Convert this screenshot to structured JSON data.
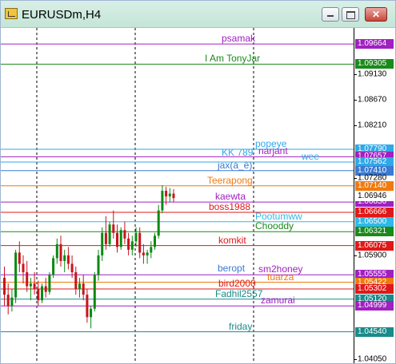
{
  "window": {
    "title": "EURUSDm,H4",
    "buttons": {
      "minimize": "–",
      "maximize": "□",
      "close": "✕"
    }
  },
  "colors": {
    "background": "#ffffff",
    "bull_candle": "#0a8a12",
    "bear_candle": "#c8141e",
    "grid": "#000000"
  },
  "price_axis": {
    "ticks": [
      "1.09130",
      "1.08670",
      "1.08210",
      "1.07280",
      "1.05900",
      "1.04050"
    ]
  },
  "levels": [
    {
      "name": "psamak",
      "price": "1.09664",
      "color": "#a020c0",
      "tag_color": "#a020c0"
    },
    {
      "name": "I Am TonyJar",
      "price": "1.09305",
      "color": "#1a8a1a",
      "tag_color": "#1a8a1a"
    },
    {
      "name": "popeye",
      "price": "1.07790",
      "color": "#30a8e8",
      "tag_color": "#30a8e8"
    },
    {
      "name": "narjant",
      "price": "1.07657",
      "color": "#a020c0",
      "tag_color": "#a020c0"
    },
    {
      "name": "KK 789",
      "price": "",
      "color": "#30a8e8",
      "tag_color": "#30a8e8"
    },
    {
      "name": "wee",
      "price": "1.07562",
      "color": "#30a8e8",
      "tag_color": "#30a8e8"
    },
    {
      "name": "jax(à_ê)",
      "price": "1.07410",
      "color": "#3a7ad0",
      "tag_color": "#3a7ad0"
    },
    {
      "name": "Teerapong",
      "price": "1.07140",
      "color": "#f07a10",
      "tag_color": "#f07a10"
    },
    {
      "name": "kaewta",
      "price": "1.06850",
      "color": "#a020c0",
      "tag_color": "#a020c0"
    },
    {
      "name": "boss1988",
      "price": "1.06666",
      "color": "#e01818",
      "tag_color": "#e01818"
    },
    {
      "name": "Pootumww",
      "price": "1.06500",
      "color": "#30b8e8",
      "tag_color": "#30b8e8"
    },
    {
      "name": "Chooddy",
      "price": "1.06321",
      "color": "#1a8a1a",
      "tag_color": "#1a8a1a"
    },
    {
      "name": "komkit",
      "price": "1.06075",
      "color": "#e01818",
      "tag_color": "#e01818"
    },
    {
      "name": "sm2honey",
      "price": "1.05555",
      "color": "#a020c0",
      "tag_color": "#a020c0"
    },
    {
      "name": "beropt",
      "price": "",
      "color": "#3a7ad0",
      "tag_color": "#3a7ad0"
    },
    {
      "name": "tuarza",
      "price": "1.05422",
      "color": "#f07a10",
      "tag_color": "#f07a10"
    },
    {
      "name": "bird2000",
      "price": "1.05302",
      "color": "#e01818",
      "tag_color": "#e01818"
    },
    {
      "name": "Fadhil2557",
      "price": "1.05120",
      "color": "#1a8a8a",
      "tag_color": "#1a8a8a"
    },
    {
      "name": "zamurai",
      "price": "1.04999",
      "color": "#a020c0",
      "tag_color": "#a020c0"
    },
    {
      "name": "friday",
      "price": "1.04540",
      "color": "#1a8a8a",
      "tag_color": "#1a8a8a"
    }
  ],
  "current_price": "1.06946",
  "chart_data": {
    "type": "candlestick",
    "symbol": "EURUSDm",
    "timeframe": "H4",
    "ylim": [
      1.0398,
      1.0995
    ],
    "candles": [
      [
        1.055,
        1.057,
        1.05,
        1.052
      ],
      [
        1.052,
        1.054,
        1.0485,
        1.05
      ],
      [
        1.05,
        1.053,
        1.049,
        1.0515
      ],
      [
        1.0515,
        1.06,
        1.0505,
        1.0595
      ],
      [
        1.0595,
        1.0615,
        1.056,
        1.0575
      ],
      [
        1.0575,
        1.059,
        1.054,
        1.056
      ],
      [
        1.056,
        1.058,
        1.0525,
        1.0535
      ],
      [
        1.0535,
        1.055,
        1.051,
        1.054
      ],
      [
        1.054,
        1.056,
        1.052,
        1.053
      ],
      [
        1.053,
        1.0545,
        1.05,
        1.051
      ],
      [
        1.051,
        1.054,
        1.0505,
        1.0535
      ],
      [
        1.0535,
        1.055,
        1.0515,
        1.0525
      ],
      [
        1.0525,
        1.056,
        1.052,
        1.0555
      ],
      [
        1.0555,
        1.059,
        1.055,
        1.0585
      ],
      [
        1.0585,
        1.062,
        1.0575,
        1.061
      ],
      [
        1.061,
        1.0625,
        1.057,
        1.058
      ],
      [
        1.058,
        1.06,
        1.056,
        1.059
      ],
      [
        1.059,
        1.0605,
        1.0565,
        1.0575
      ],
      [
        1.0575,
        1.059,
        1.055,
        1.056
      ],
      [
        1.056,
        1.057,
        1.052,
        1.053
      ],
      [
        1.053,
        1.055,
        1.0515,
        1.054
      ],
      [
        1.054,
        1.0555,
        1.051,
        1.052
      ],
      [
        1.052,
        1.053,
        1.047,
        1.048
      ],
      [
        1.048,
        1.05,
        1.046,
        1.0495
      ],
      [
        1.0495,
        1.056,
        1.049,
        1.0555
      ],
      [
        1.0555,
        1.06,
        1.0545,
        1.059
      ],
      [
        1.059,
        1.064,
        1.058,
        1.063
      ],
      [
        1.063,
        1.066,
        1.06,
        1.061
      ],
      [
        1.061,
        1.065,
        1.0605,
        1.0645
      ],
      [
        1.0645,
        1.067,
        1.062,
        1.063
      ],
      [
        1.063,
        1.0645,
        1.0595,
        1.0605
      ],
      [
        1.0605,
        1.064,
        1.06,
        1.0635
      ],
      [
        1.0635,
        1.065,
        1.061,
        1.062
      ],
      [
        1.062,
        1.063,
        1.059,
        1.06
      ],
      [
        1.06,
        1.0625,
        1.059,
        1.0615
      ],
      [
        1.0615,
        1.064,
        1.0605,
        1.063
      ],
      [
        1.063,
        1.064,
        1.0585,
        1.0595
      ],
      [
        1.0595,
        1.061,
        1.0575,
        1.059
      ],
      [
        1.059,
        1.06,
        1.0575,
        1.0595
      ],
      [
        1.0595,
        1.0615,
        1.0585,
        1.0605
      ],
      [
        1.0605,
        1.063,
        1.06,
        1.0625
      ],
      [
        1.0625,
        1.068,
        1.062,
        1.067
      ],
      [
        1.067,
        1.0715,
        1.0665,
        1.0705
      ],
      [
        1.0705,
        1.0712,
        1.068,
        1.0695
      ],
      [
        1.0695,
        1.071,
        1.0685,
        1.07
      ],
      [
        1.07,
        1.0708,
        1.0685,
        1.0692
      ]
    ]
  }
}
